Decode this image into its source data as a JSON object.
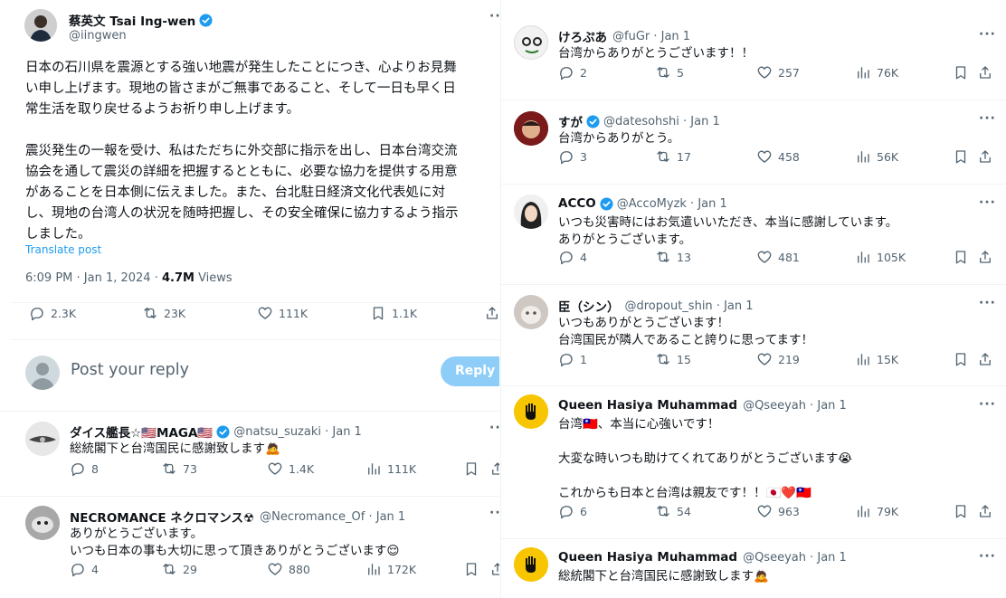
{
  "main_post": {
    "name": "蔡英文 Tsai Ing-wen",
    "handle": "@iingwen",
    "lines": [
      "日本の石川県を震源とする強い地震が発生したことにつき、心よりお見舞",
      "い申し上げます。現地の皆さまがご無事であること、そして一日も早く日",
      "常生活を取り戻せるようお祈り申し上げます。",
      "",
      "震災発生の一報を受け、私はただちに外交部に指示を出し、日本台湾交流",
      "協会を通して震災の詳細を把握するとともに、必要な協力を提供する用意",
      "があることを日本側に伝えました。また、台北駐日経済文化代表処に対",
      "し、現地の台湾人の状況を随時把握し、その安全確保に協力するよう指示",
      "しました。"
    ],
    "translate": "Translate post",
    "time": "6:09 PM · Jan 1, 2024 · ",
    "views_count": "4.7M",
    "views_label": " Views",
    "replies": "2.3K",
    "reposts": "23K",
    "likes": "111K",
    "bookmarks": "1.1K"
  },
  "reply_box": {
    "placeholder": "Post your reply",
    "button": "Reply"
  },
  "left_replies": [
    {
      "name": "ダイス艦長☆🇺🇸MAGA🇺🇸",
      "handle": "@natsu_suzaki · Jan 1",
      "text": "総統閣下と台湾国民に感謝致します🙇",
      "replies": "8",
      "reposts": "73",
      "likes": "1.4K",
      "views": "111K"
    },
    {
      "name": "NECROMANCE ネクロマンス☢",
      "handle": "@Necromance_Of · Jan 1",
      "text": "ありがとうございます。\nいつも日本の事も大切に思って頂きありがとうございます😌",
      "replies": "4",
      "reposts": "29",
      "likes": "880",
      "views": "172K"
    }
  ],
  "right_replies": [
    {
      "name": "けろぷあ",
      "handle": "@fuGr · Jan 1",
      "text": "台湾からありがとうございます！！",
      "replies": "2",
      "reposts": "5",
      "likes": "257",
      "views": "76K"
    },
    {
      "name": "すが",
      "handle": "@datesohshi · Jan 1",
      "text": "台湾からありがとう。",
      "replies": "3",
      "reposts": "17",
      "likes": "458",
      "views": "56K"
    },
    {
      "name": "ACCO",
      "handle": "@AccoMyzk · Jan 1",
      "text": "いつも災害時にはお気遣いいただき、本当に感謝しています。\nありがとうございます。",
      "replies": "4",
      "reposts": "13",
      "likes": "481",
      "views": "105K"
    },
    {
      "name": "臣（シン）",
      "handle": "@dropout_shin · Jan 1",
      "text": "いつもありがとうございます！\n台湾国民が隣人であること誇りに思ってます！",
      "replies": "1",
      "reposts": "15",
      "likes": "219",
      "views": "15K"
    },
    {
      "name": "Queen Hasiya Muhammad",
      "handle": "@Qseeyah · Jan 1",
      "text": "台湾🇹🇼、本当に心強いです！\n\n大変な時いつも助けてくれてありがとうございます😭\n\nこれからも日本と台湾は親友です！！🇯🇵❤️🇹🇼",
      "replies": "6",
      "reposts": "54",
      "likes": "963",
      "views": "79K"
    },
    {
      "name": "Queen Hasiya Muhammad",
      "handle": "@Qseeyah · Jan 1",
      "text": "総統閣下と台湾国民に感謝致します🙇"
    }
  ],
  "more_label": "···",
  "colors": {
    "blue": "#1d9bf0",
    "muted": "#536471",
    "border": "#eff3f4",
    "reply_button": "#8ecdf8"
  }
}
